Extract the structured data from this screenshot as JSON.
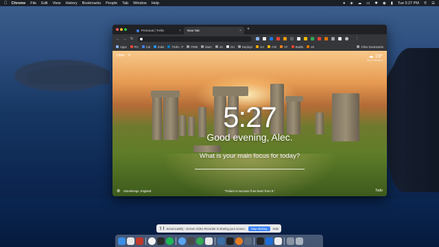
{
  "menubar": {
    "app_name": "Chrome",
    "items": [
      "File",
      "Edit",
      "View",
      "History",
      "Bookmarks",
      "People",
      "Tab",
      "Window",
      "Help"
    ],
    "clock": "Tue 5:27 PM"
  },
  "browser": {
    "tabs": [
      {
        "title": "Personal | Trello"
      },
      {
        "title": "New Tab"
      }
    ],
    "omnibox": {
      "placeholder": ""
    },
    "bookmarks": [
      "Apps",
      "PO",
      "Cal",
      "Zube",
      "Trello - P",
      "PMM",
      "Marn",
      "JH",
      "GH",
      "Deploys",
      "GA",
      "CW",
      "CF",
      "Builds",
      "e9"
    ],
    "other_bookmarks": "Other Bookmarks"
  },
  "momentum": {
    "links_label": "Links",
    "weather": {
      "temp": "19°",
      "location": "San Francisco"
    },
    "time": "5:27",
    "greeting": "Good evening, Alec.",
    "focus_prompt": "What is your main focus for today?",
    "photo_location": "Stonehenge, England",
    "quote": "“Failure is success if we learn from it.”",
    "todo_label": "Todo"
  },
  "screen_sharing": {
    "message": "Screencastify - Screen Video Recorder is sharing your screen.",
    "stop_label": "Stop sharing",
    "hide_label": "Hide"
  },
  "colors": {
    "stop_button": "#3b82f6",
    "menubar": "#1b1f26",
    "chrome_dark": "#35363a"
  }
}
